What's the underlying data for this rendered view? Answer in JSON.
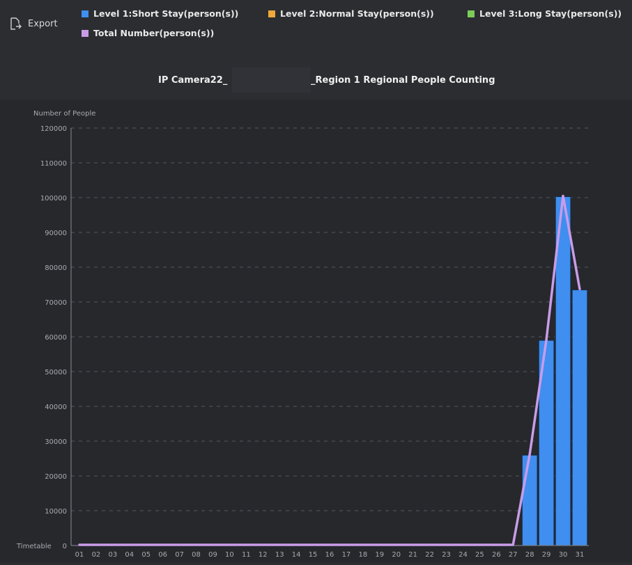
{
  "toolbar": {
    "export_label": "Export",
    "export_icon": "export-icon"
  },
  "legend": [
    {
      "label": "Level 1:Short Stay(person(s))",
      "color": "#3f8ef0"
    },
    {
      "label": "Level 2:Normal Stay(person(s))",
      "color": "#f0a83a"
    },
    {
      "label": "Level 3:Long Stay(person(s))",
      "color": "#7ccc58"
    },
    {
      "label": "Total Number(person(s))",
      "color": "#c99ce8"
    }
  ],
  "title": {
    "prefix": "IP Camera22_",
    "suffix": "_Region 1 Regional People Counting"
  },
  "chart_data": {
    "type": "bar",
    "ylabel": "Number of People",
    "xlabel": "Timetable",
    "ylim": [
      0,
      120000
    ],
    "yticks": [
      0,
      10000,
      20000,
      30000,
      40000,
      50000,
      60000,
      70000,
      80000,
      90000,
      100000,
      110000,
      120000
    ],
    "grid": true,
    "categories": [
      "01",
      "02",
      "03",
      "04",
      "05",
      "06",
      "07",
      "08",
      "09",
      "10",
      "11",
      "12",
      "13",
      "14",
      "15",
      "16",
      "17",
      "18",
      "19",
      "20",
      "21",
      "22",
      "23",
      "24",
      "25",
      "26",
      "27",
      "28",
      "29",
      "30",
      "31"
    ],
    "series": [
      {
        "name": "Level 1:Short Stay(person(s))",
        "type": "bar",
        "color": "#3f8ef0",
        "values": [
          0,
          0,
          0,
          0,
          0,
          0,
          0,
          0,
          0,
          0,
          0,
          0,
          0,
          0,
          0,
          0,
          0,
          0,
          0,
          0,
          0,
          0,
          0,
          0,
          0,
          0,
          0,
          26000,
          59000,
          100300,
          73500
        ]
      },
      {
        "name": "Level 2:Normal Stay(person(s))",
        "type": "bar",
        "color": "#f0a83a",
        "values": [
          0,
          0,
          0,
          0,
          0,
          0,
          0,
          0,
          0,
          0,
          0,
          0,
          0,
          0,
          0,
          0,
          0,
          0,
          0,
          0,
          0,
          0,
          0,
          0,
          0,
          0,
          0,
          0,
          0,
          0,
          0
        ]
      },
      {
        "name": "Level 3:Long Stay(person(s))",
        "type": "bar",
        "color": "#7ccc58",
        "values": [
          0,
          0,
          0,
          0,
          0,
          0,
          0,
          0,
          0,
          0,
          0,
          0,
          0,
          0,
          0,
          0,
          0,
          0,
          0,
          0,
          0,
          0,
          0,
          0,
          0,
          0,
          0,
          0,
          0,
          0,
          0
        ]
      },
      {
        "name": "Total Number(person(s))",
        "type": "line",
        "color": "#c99ce8",
        "values": [
          0,
          0,
          0,
          0,
          0,
          0,
          0,
          0,
          0,
          0,
          0,
          0,
          0,
          0,
          0,
          0,
          0,
          0,
          0,
          0,
          0,
          0,
          0,
          0,
          0,
          0,
          0,
          26000,
          59000,
          100300,
          73500
        ]
      }
    ]
  }
}
